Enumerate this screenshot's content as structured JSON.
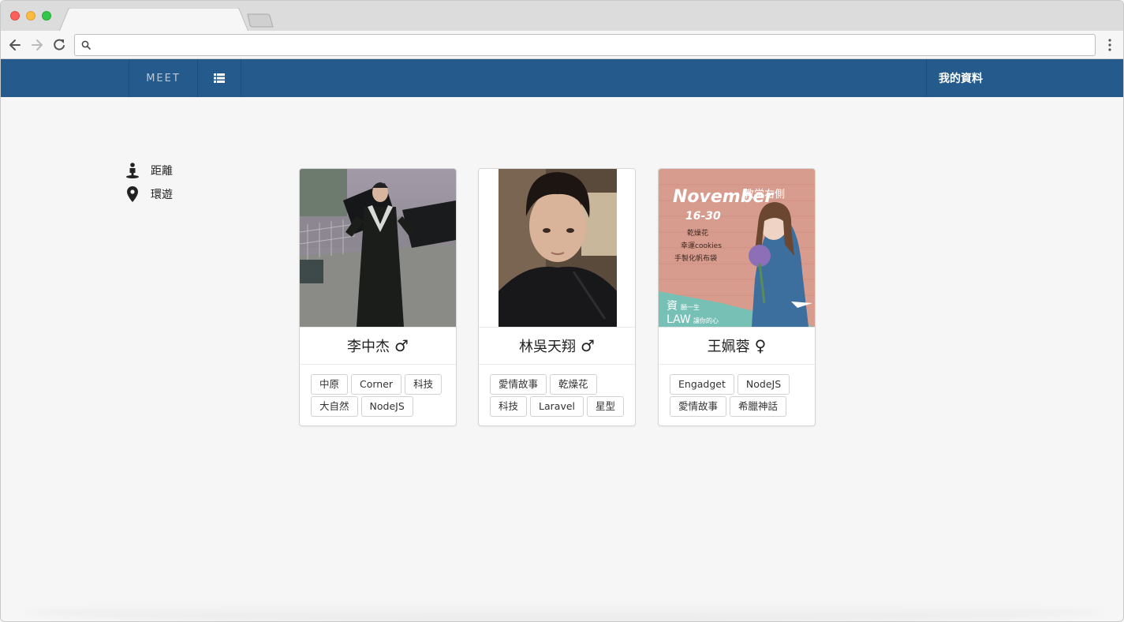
{
  "browser": {
    "tab_title": "",
    "address": ""
  },
  "navbar": {
    "brand": "MEET",
    "list_icon": "list-icon",
    "profile_label": "我的資料",
    "bg_color": "#245a8c"
  },
  "sidebar": {
    "items": [
      {
        "icon": "person-pin-icon",
        "label": "距離"
      },
      {
        "icon": "map-marker-icon",
        "label": "環遊"
      }
    ]
  },
  "cards": [
    {
      "name": "李中杰",
      "gender": "♂",
      "photo": "graduation-photo",
      "tags": [
        "中原",
        "Corner",
        "科技",
        "大自然",
        "NodeJS"
      ]
    },
    {
      "name": "林吳天翔",
      "gender": "♂",
      "photo": "portrait-photo",
      "tags": [
        "愛情故事",
        "乾燥花",
        "科技",
        "Laravel",
        "星型"
      ]
    },
    {
      "name": "王姵蓉",
      "gender": "♀",
      "photo": "poster-photo",
      "tags": [
        "Engadget",
        "NodeJS",
        "愛情故事",
        "希臘神話"
      ],
      "poster": {
        "title": "November",
        "dates": "16-30",
        "right": "教学右側",
        "lines": [
          "乾燥花",
          "幸運cookies",
          "手製化帆布袋"
        ],
        "corner1": "資",
        "corner1b": "願一生",
        "corner2": "LAW",
        "corner2b": "讓你的心"
      }
    }
  ]
}
